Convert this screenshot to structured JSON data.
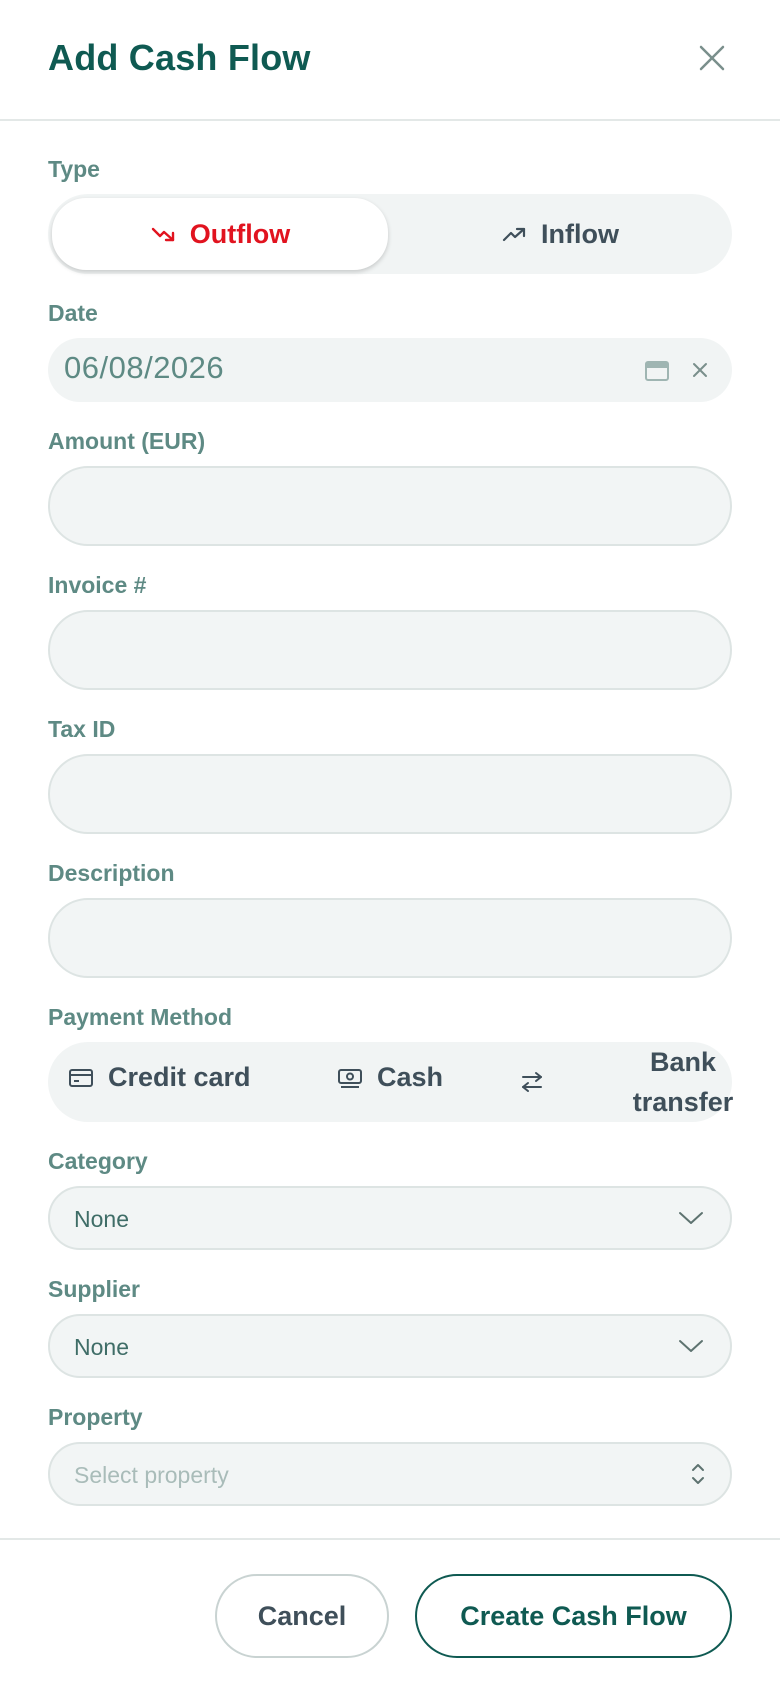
{
  "dialog": {
    "title": "Add Cash Flow"
  },
  "type": {
    "label": "Type",
    "options": [
      {
        "label": "Outflow",
        "icon": "trending-down-icon",
        "active": true,
        "color": "#e1131f"
      },
      {
        "label": "Inflow",
        "icon": "trending-up-icon",
        "active": false
      }
    ]
  },
  "date": {
    "label": "Date",
    "value": "06/08/2026"
  },
  "amount": {
    "label": "Amount (EUR)",
    "value": ""
  },
  "invoice": {
    "label": "Invoice #",
    "value": ""
  },
  "tax_id": {
    "label": "Tax ID",
    "value": ""
  },
  "description": {
    "label": "Description",
    "value": ""
  },
  "payment_method": {
    "label": "Payment Method",
    "options": [
      {
        "label": "Credit card",
        "icon": "credit-card-icon"
      },
      {
        "label": "Cash",
        "icon": "banknote-icon"
      },
      {
        "label_line1": "Bank",
        "label_line2": "transfer",
        "icon": "transfer-arrows-icon"
      }
    ]
  },
  "category": {
    "label": "Category",
    "value": "None"
  },
  "supplier": {
    "label": "Supplier",
    "value": "None"
  },
  "property": {
    "label": "Property",
    "placeholder": "Select property"
  },
  "footer": {
    "cancel_label": "Cancel",
    "create_label": "Create Cash Flow"
  },
  "colors": {
    "brand": "#0f5a52",
    "label": "#5e8a84",
    "danger": "#e1131f",
    "field_bg": "#f2f5f5"
  }
}
